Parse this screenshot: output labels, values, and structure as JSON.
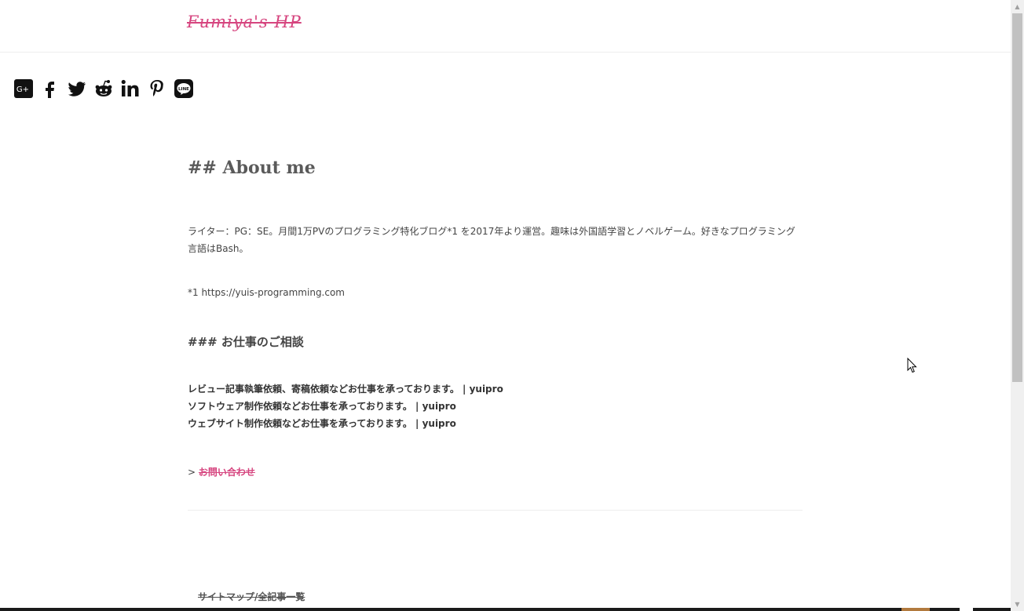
{
  "header": {
    "logo": "Fumiya's HP"
  },
  "share": {
    "items": [
      {
        "icon": "google-plus-icon"
      },
      {
        "icon": "facebook-icon"
      },
      {
        "icon": "twitter-icon"
      },
      {
        "icon": "reddit-icon"
      },
      {
        "icon": "linkedin-icon"
      },
      {
        "icon": "pinterest-icon"
      },
      {
        "icon": "line-icon"
      }
    ]
  },
  "main": {
    "about_heading": "## About me",
    "intro": "ライター：PG：SE。月間1万PVのプログラミング特化ブログ*1 を2017年より運営。趣味は外国語学習とノベルゲーム。好きなプログラミング言語はBash。",
    "footnote": "*1 https://yuis-programming.com",
    "work_heading": "### お仕事のご相談",
    "work_items": [
      "レビュー記事執筆依頼、寄稿依頼などお仕事を承っております。 | yuipro",
      "ソフトウェア制作依頼などお仕事を承っております。 | yuipro",
      "ウェブサイト制作依頼などお仕事を承っております。 | yuipro"
    ],
    "contact_prefix": ">",
    "contact_link": "お問い合わせ"
  },
  "footer": {
    "sitemap_link": "サイトマップ/全記事一覧"
  },
  "colors": {
    "accent": "#d6457f",
    "text": "#333333"
  }
}
